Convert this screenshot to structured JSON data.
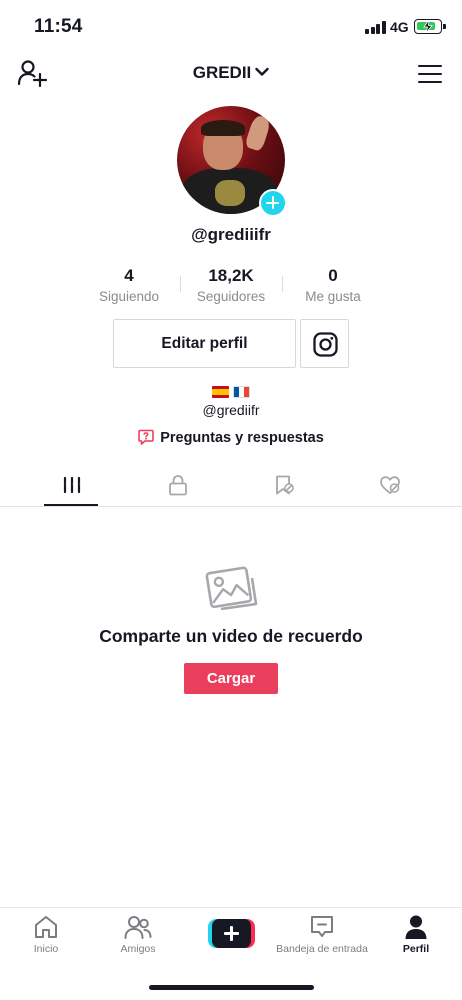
{
  "status_bar": {
    "time": "11:54",
    "network": "4G",
    "battery_state": "charging"
  },
  "header": {
    "title": "GREDII",
    "add_user_icon": "add-user-icon",
    "menu_icon": "hamburger-menu-icon"
  },
  "profile": {
    "handle": "@grediiifr",
    "stats": [
      {
        "value": "4",
        "label": "Siguiendo"
      },
      {
        "value": "18,2K",
        "label": "Seguidores"
      },
      {
        "value": "0",
        "label": "Me gusta"
      }
    ],
    "edit_button": "Editar perfil",
    "instagram_icon": "instagram-icon",
    "bio_flags": [
      "spain-flag",
      "france-flag"
    ],
    "bio_handle": "@grediifr",
    "qa_link": "Preguntas y respuestas"
  },
  "tabs": [
    {
      "icon": "videos-grid-icon",
      "active": true
    },
    {
      "icon": "lock-icon",
      "active": false
    },
    {
      "icon": "saved-bookmark-icon",
      "active": false
    },
    {
      "icon": "liked-heart-icon",
      "active": false
    }
  ],
  "empty_state": {
    "icon": "photo-gallery-icon",
    "title": "Comparte un video de recuerdo",
    "button": "Cargar"
  },
  "bottom_nav": [
    {
      "label": "Inicio",
      "icon": "home-icon",
      "active": false
    },
    {
      "label": "Amigos",
      "icon": "friends-icon",
      "active": false
    },
    {
      "label": "",
      "icon": "create-plus-icon",
      "active": false
    },
    {
      "label": "Bandeja de entrada",
      "icon": "inbox-icon",
      "active": false
    },
    {
      "label": "Perfil",
      "icon": "profile-icon",
      "active": true
    }
  ],
  "colors": {
    "accent_red": "#ea3f5c",
    "accent_cyan": "#20d5ec",
    "text": "#161823",
    "muted": "#8a8b91"
  }
}
